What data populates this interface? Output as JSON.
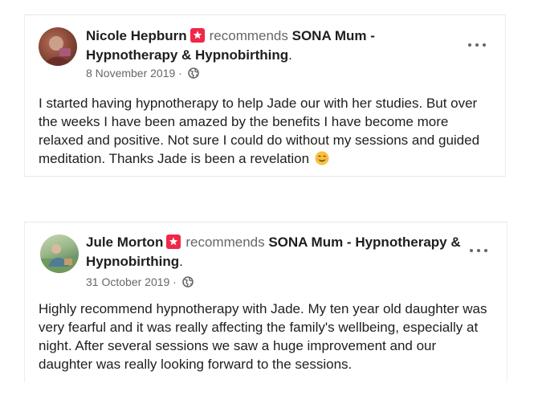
{
  "reviews": [
    {
      "name": "Nicole Hepburn",
      "recommends": "recommends",
      "page": "SONA Mum - Hypnotherapy & Hypnobirthing",
      "period": ".",
      "date": "8 November 2019",
      "separator": " ·",
      "text": "I started having hypnotherapy to help Jade our with her studies.  But over the weeks I have been amazed by the benefits I have become more relaxed and positive.  Not sure I could do without my sessions and guided meditation.  Thanks Jade is been a revelation",
      "emoji": "smiling-face-emoji"
    },
    {
      "name": "Jule Morton",
      "recommends": "recommends",
      "page": "SONA Mum - Hypnotherapy & Hypnobirthing",
      "period": ".",
      "date": "31 October 2019",
      "separator": " ·",
      "text": "Highly recommend hypnotherapy with Jade. My ten year old daughter was very fearful and it was really affecting the family's wellbeing, especially at night. After several sessions we saw a huge improvement and our daughter was really looking forward to the sessions."
    }
  ],
  "icons": {
    "recommend": "recommend-icon",
    "privacy": "globe-icon",
    "more": "more-options-icon"
  },
  "colors": {
    "recommend_icon": "#f02849",
    "secondary_text": "#65676b",
    "primary_text": "#1c1e21"
  }
}
